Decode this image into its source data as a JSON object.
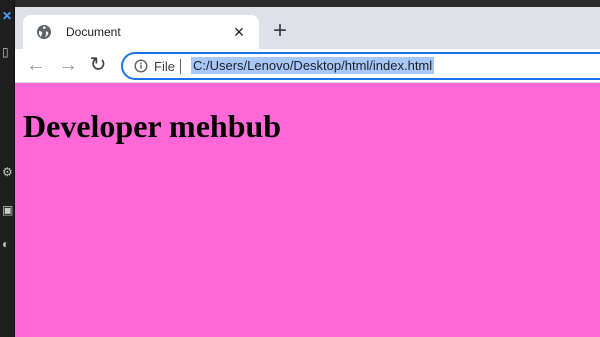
{
  "browser": {
    "tab": {
      "title": "Document",
      "favicon_icon": "globe-icon",
      "close_icon": "close-icon"
    },
    "new_tab_icon": "plus-icon",
    "toolbar": {
      "back_icon": "arrow-left-icon",
      "forward_icon": "arrow-right-icon",
      "reload_icon": "reload-icon",
      "site_info_icon": "info-icon",
      "file_label": "File",
      "url": "C:/Users/Lenovo/Desktop/html/index.html"
    }
  },
  "page": {
    "background_color": "#ff68d6",
    "heading": "Developer mehbub"
  },
  "colors": {
    "tabstrip": "#dee1e6",
    "url_highlight": "#a8c7fa",
    "focus_ring": "#1a73e8"
  }
}
